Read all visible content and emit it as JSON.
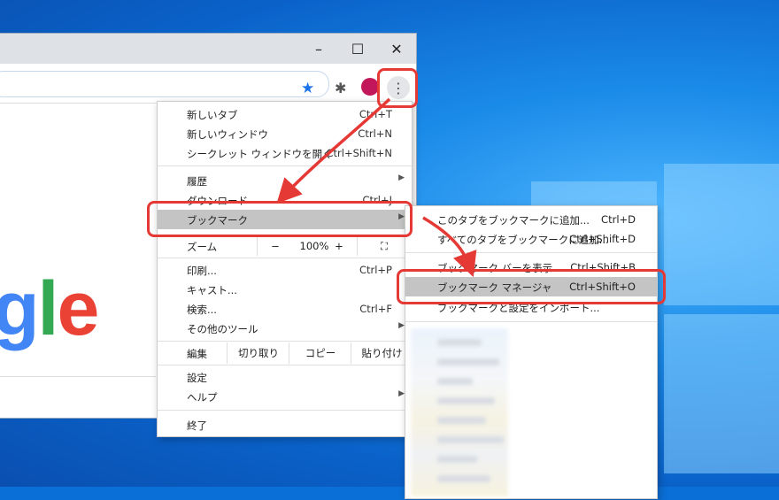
{
  "window": {
    "minimize_icon": "–",
    "maximize_icon": "☐",
    "close_icon": "✕"
  },
  "toolbar": {
    "star_icon": "★",
    "extensions_icon": "✱",
    "menu_icon": "⋮"
  },
  "page": {
    "logo_visible_text": [
      "g",
      "l",
      "e"
    ]
  },
  "menu": {
    "new_tab": {
      "label": "新しいタブ",
      "shortcut": "Ctrl+T"
    },
    "new_window": {
      "label": "新しいウィンドウ",
      "shortcut": "Ctrl+N"
    },
    "incognito": {
      "label": "シークレット ウィンドウを開く",
      "shortcut": "Ctrl+Shift+N"
    },
    "history": {
      "label": "履歴"
    },
    "downloads": {
      "label": "ダウンロード",
      "shortcut": "Ctrl+J"
    },
    "bookmarks": {
      "label": "ブックマーク"
    },
    "zoom": {
      "label": "ズーム",
      "minus": "−",
      "value": "100%",
      "plus": "+",
      "fullscreen": "⛶"
    },
    "print": {
      "label": "印刷...",
      "shortcut": "Ctrl+P"
    },
    "cast": {
      "label": "キャスト..."
    },
    "find": {
      "label": "検索...",
      "shortcut": "Ctrl+F"
    },
    "more_tools": {
      "label": "その他のツール"
    },
    "edit": {
      "label": "編集",
      "cut": "切り取り",
      "copy": "コピー",
      "paste": "貼り付け"
    },
    "settings": {
      "label": "設定"
    },
    "help": {
      "label": "ヘルプ"
    },
    "exit": {
      "label": "終了"
    }
  },
  "submenu": {
    "bookmark_tab": {
      "label": "このタブをブックマークに追加...",
      "shortcut": "Ctrl+D"
    },
    "bookmark_all": {
      "label": "すべてのタブをブックマークに追加...",
      "shortcut": "Ctrl+Shift+D"
    },
    "show_bar": {
      "label": "ブックマーク バーを表示",
      "shortcut": "Ctrl+Shift+B"
    },
    "manager": {
      "label": "ブックマーク マネージャ",
      "shortcut": "Ctrl+Shift+O"
    },
    "import": {
      "label": "ブックマークと設定をインポート..."
    }
  },
  "colors": {
    "highlight": "#e53935",
    "menu_hover": "#c4c4c4"
  }
}
